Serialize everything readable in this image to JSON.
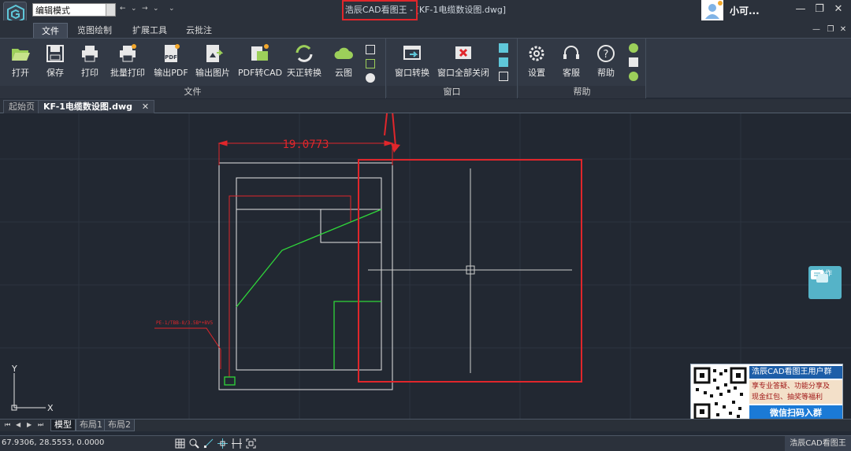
{
  "titlebar": {
    "mode": "编辑模式",
    "title": "浩辰CAD看图王 - [KF-1电缆数设图.dwg]",
    "user_name": "小可...",
    "minimize": "—",
    "restore": "❐",
    "close": "✕",
    "undo": "←",
    "redo": "→",
    "qa_arrow": "⌄"
  },
  "ribbon_tabs": [
    "文件",
    "览图绘制",
    "扩展工具",
    "云批注"
  ],
  "ribbon": {
    "file_group": {
      "label": "文件",
      "buttons": [
        "打开",
        "保存",
        "打印",
        "批量打印",
        "输出PDF",
        "输出图片",
        "PDF转CAD",
        "天正转换",
        "云图"
      ]
    },
    "window_group": {
      "label": "窗口",
      "buttons": [
        "窗口转换",
        "窗口全部关闭"
      ]
    },
    "help_group": {
      "label": "帮助",
      "buttons": [
        "设置",
        "客服",
        "帮助"
      ]
    }
  },
  "doc_tabs": {
    "start": "起始页",
    "active": "KF-1电缆数设图.dwg",
    "close": "✕"
  },
  "canvas": {
    "dimension_text": "19.0773",
    "annotation_text": "PE-1/TBB-8/3.5B*+BV5",
    "axis_y": "Y",
    "axis_x": "X"
  },
  "collab": {
    "label": "协作"
  },
  "ad": {
    "header": "浩辰CAD看图王用户群",
    "body_line1": "享专业答疑、功能分享及",
    "body_line2": "现金红包、抽奖等福利",
    "cta": "微信扫码入群"
  },
  "layout_tabs": [
    "模型",
    "布局1",
    "布局2"
  ],
  "layout_nav": [
    "⏮",
    "◀",
    "▶",
    "⏭"
  ],
  "status": {
    "coords": "67.9306, 28.5553, 0.0000",
    "brand": "浩辰CAD看图王"
  },
  "colors": {
    "highlight_red": "#e0262b",
    "canvas_bg": "#222832",
    "green_line": "#2fd63a"
  }
}
